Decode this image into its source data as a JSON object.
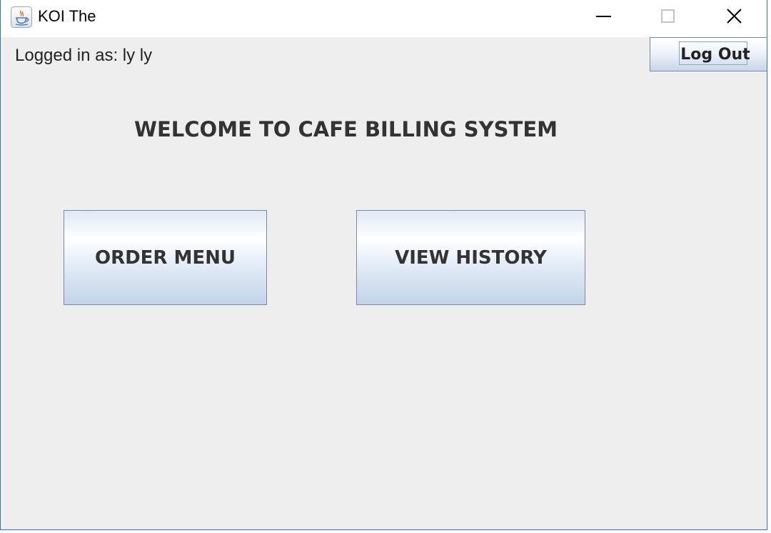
{
  "window": {
    "title": "KOI The",
    "icon": "java-cup-icon",
    "controls": [
      "minimize-icon",
      "maximize-icon",
      "close-icon"
    ],
    "accent_color": "#2b79c4"
  },
  "header": {
    "logged_in_text": "Logged in as: ly ly",
    "logout_label": "Log Out"
  },
  "main": {
    "welcome_text": "WELCOME TO CAFE BILLING SYSTEM",
    "order_menu_label": "ORDER MENU",
    "view_history_label": "VIEW HISTORY"
  }
}
